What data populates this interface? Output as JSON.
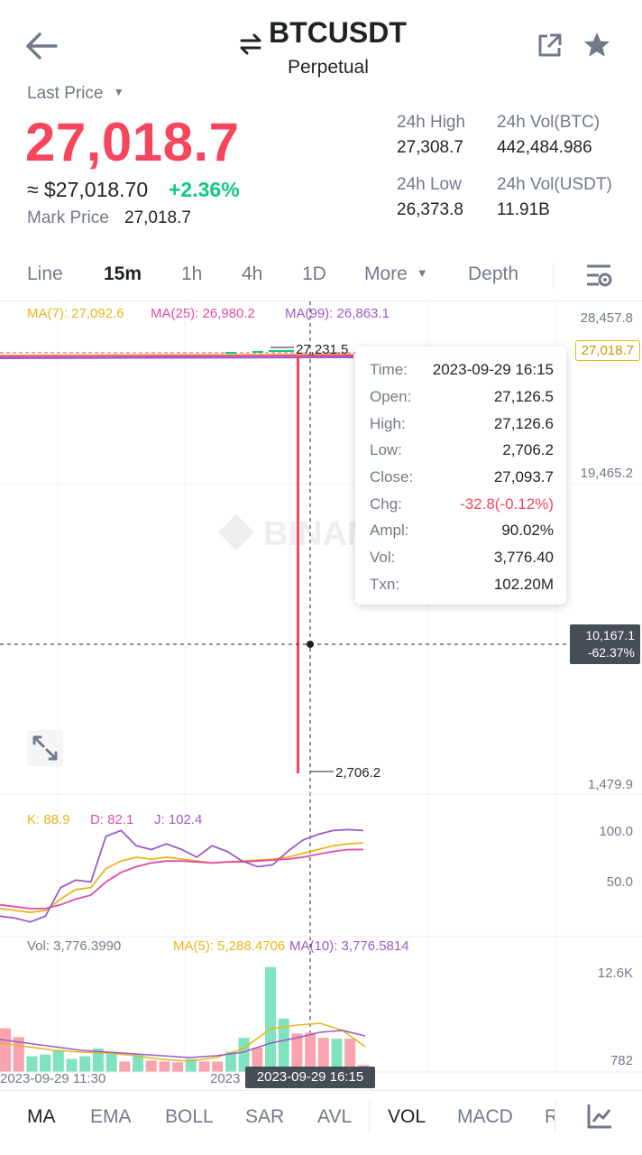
{
  "header": {
    "title": "BTCUSDT",
    "subtitle": "Perpetual"
  },
  "price": {
    "label": "Last Price",
    "last": "27,018.7",
    "usd": "≈ $27,018.70",
    "change": "+2.36%",
    "mark_label": "Mark Price",
    "mark": "27,018.7"
  },
  "stats": {
    "high_label": "24h High",
    "high": "27,308.7",
    "vol_btc_label": "24h Vol(BTC)",
    "vol_btc": "442,484.986",
    "low_label": "24h Low",
    "low": "26,373.8",
    "vol_usdt_label": "24h Vol(USDT)",
    "vol_usdt": "11.91B"
  },
  "timeframes": [
    "Line",
    "15m",
    "1h",
    "4h",
    "1D",
    "More",
    "Depth"
  ],
  "active_timeframe": "15m",
  "ma": {
    "ma7": "MA(7): 27,092.6",
    "ma25": "MA(25): 26,980.2",
    "ma99": "MA(99): 26,863.1"
  },
  "axis": {
    "top": "28,457.8",
    "mid": "19,465.2",
    "bottom": "1,479.9",
    "current": "27,018.7",
    "cross_price": "10,167.1",
    "cross_pct": "-62.37%"
  },
  "annotations": {
    "high": "27,231.5",
    "low": "2,706.2"
  },
  "watermark": "BINANCE",
  "tooltip": {
    "rows": [
      {
        "k": "Time:",
        "v": "2023-09-29 16:15"
      },
      {
        "k": "Open:",
        "v": "27,126.5"
      },
      {
        "k": "High:",
        "v": "27,126.6"
      },
      {
        "k": "Low:",
        "v": "2,706.2"
      },
      {
        "k": "Close:",
        "v": "27,093.7"
      },
      {
        "k": "Chg:",
        "v": "-32.8(-0.12%)"
      },
      {
        "k": "Ampl:",
        "v": "90.02%"
      },
      {
        "k": "Vol:",
        "v": "3,776.40"
      },
      {
        "k": "Txn:",
        "v": "102.20M"
      }
    ]
  },
  "kdj": {
    "k": "K: 88.9",
    "d": "D: 82.1",
    "j": "J: 102.4",
    "axis_top": "100.0",
    "axis_mid": "50.0"
  },
  "vol": {
    "vol": "Vol: 3,776.3990",
    "ma5": "MA(5): 5,288.4706",
    "ma10": "MA(10): 3,776.5814",
    "axis_top": "12.6K",
    "axis_bottom": "782"
  },
  "time_axis": {
    "left": "2023-09-29 11:30",
    "mid": "2023",
    "cross": "2023-09-29 16:15"
  },
  "bottom_tabs": [
    "MA",
    "EMA",
    "BOLL",
    "SAR",
    "AVL",
    "VOL",
    "MACD",
    "R"
  ],
  "colors": {
    "red": "#f6465d",
    "green": "#0ecb81",
    "ma7": "#e8b61a",
    "ma25": "#e34ba5",
    "ma99": "#9b5cc9"
  },
  "kdj_series": {
    "k": [
      20,
      18,
      16,
      18,
      30,
      40,
      42,
      62,
      70,
      74,
      72,
      74,
      72,
      70,
      68,
      69,
      70,
      71,
      72,
      74,
      78,
      82,
      86,
      88,
      89
    ],
    "d": [
      24,
      22,
      20,
      20,
      24,
      30,
      34,
      48,
      58,
      64,
      68,
      70,
      70,
      69,
      68,
      69,
      69,
      70,
      71,
      72,
      74,
      77,
      80,
      82,
      82
    ],
    "j": [
      12,
      10,
      6,
      12,
      42,
      50,
      48,
      96,
      102,
      86,
      82,
      88,
      82,
      74,
      86,
      80,
      70,
      64,
      66,
      80,
      92,
      98,
      102,
      103,
      102
    ]
  },
  "volume_series": {
    "values": [
      5.0,
      4.0,
      1.8,
      2.0,
      2.5,
      1.5,
      1.8,
      2.7,
      2.3,
      1.2,
      2.0,
      1.3,
      1.2,
      1.1,
      1.5,
      1.2,
      1.2,
      2.3,
      3.9,
      2.8,
      12.0,
      6.1,
      4.4,
      4.5,
      3.9,
      3.8,
      3.8,
      0.8
    ],
    "up": [
      false,
      false,
      true,
      true,
      true,
      true,
      true,
      true,
      true,
      false,
      true,
      false,
      false,
      false,
      true,
      false,
      false,
      true,
      true,
      false,
      true,
      true,
      false,
      false,
      false,
      true,
      false,
      false
    ]
  }
}
